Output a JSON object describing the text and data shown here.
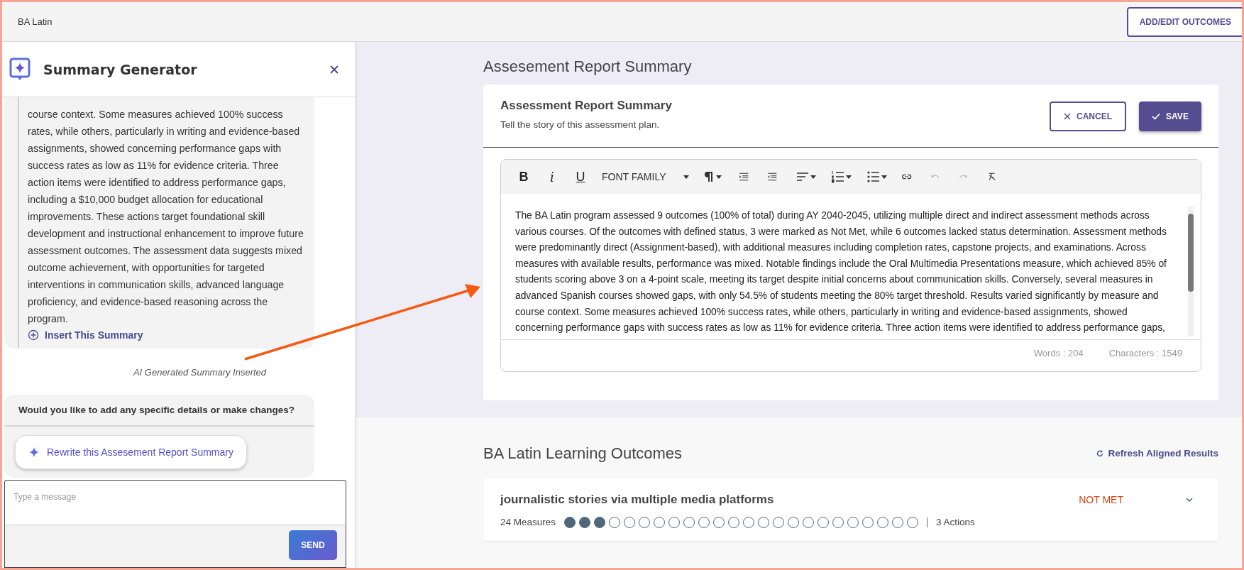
{
  "header": {
    "title": "BA Latin",
    "action": "ADD/EDIT OUTCOMES"
  },
  "summary_generator": {
    "title": "Summary Generator",
    "messages": [
      {
        "kind": "summary",
        "text": "course context. Some measures achieved 100% success rates, while others, particularly in writing and evidence-based assignments, showed concerning performance gaps with success rates as low as 11% for evidence criteria. Three action items were identified to address performance gaps, including a $10,000 budget allocation for educational improvements. These actions target foundational skill development and instructional enhancement to improve future assessment outcomes. The assessment data suggests mixed outcome achievement, with opportunities for targeted interventions in communication skills, advanced language proficiency, and evidence-based reasoning across the program.",
        "action": "Insert This Summary"
      },
      {
        "kind": "status",
        "text": "AI Generated Summary Inserted"
      },
      {
        "kind": "question",
        "text": "Would you like to add any specific details or make changes?",
        "action": "Rewrite this Assesement Report Summary"
      }
    ],
    "input": {
      "placeholder": "Type a message"
    },
    "send": "SEND"
  },
  "report": {
    "section_title": "Assesement Report Summary",
    "card_title": "Assessment Report Summary",
    "subtitle": "Tell the story of this assessment plan.",
    "cancel": "CANCEL",
    "save": "SAVE",
    "toolbar": [
      {
        "kind": "bold",
        "label": "B",
        "disabled": false
      },
      {
        "kind": "italic",
        "label": "i",
        "disabled": false
      },
      {
        "kind": "underline",
        "label": "U",
        "disabled": false
      },
      {
        "kind": "font",
        "label": "FONT FAMILY",
        "disabled": false
      },
      {
        "kind": "paragraph",
        "disabled": false
      },
      {
        "kind": "indent",
        "disabled": false
      },
      {
        "kind": "outdent",
        "disabled": false
      },
      {
        "kind": "align",
        "disabled": false
      },
      {
        "kind": "ordered",
        "disabled": false
      },
      {
        "kind": "bullets",
        "disabled": false
      },
      {
        "kind": "link",
        "disabled": false
      },
      {
        "kind": "undo",
        "disabled": true
      },
      {
        "kind": "redo",
        "disabled": true
      },
      {
        "kind": "clear",
        "disabled": false
      }
    ],
    "body": "The BA Latin program assessed 9 outcomes (100% of total) during AY 2040-2045, utilizing multiple direct and indirect assessment methods across various courses. Of the outcomes with defined status, 3 were marked as Not Met, while 6 outcomes lacked status determination. Assessment methods were predominantly direct (Assignment-based), with additional measures including completion rates, capstone projects, and examinations. Across measures with available results, performance was mixed. Notable findings include the Oral Multimedia Presentations measure, which achieved 85% of students scoring above 3 on a 4-point scale, meeting its target despite initial concerns about communication skills. Conversely, several measures in advanced Spanish courses showed gaps, with only 54.5% of students meeting the 80% target threshold. Results varied significantly by measure and course context. Some measures achieved 100% success rates, while others, particularly in writing and evidence-based assignments, showed concerning performance gaps with success rates as low as 11% for evidence criteria. Three action items were identified to address performance gaps,",
    "words": "Words : 204",
    "characters": "Characters : 1549"
  },
  "outcomes": {
    "title": "BA Latin Learning Outcomes",
    "refresh": "Refresh Aligned Results",
    "items": [
      {
        "title": "journalistic stories via multiple media platforms",
        "status": "NOT MET",
        "measures_label": "24 Measures",
        "actions_label": "3 Actions",
        "measures": [
          {
            "met": true
          },
          {
            "met": true
          },
          {
            "met": true
          },
          {
            "met": false
          },
          {
            "met": false
          },
          {
            "met": false
          },
          {
            "met": false
          },
          {
            "met": false
          },
          {
            "met": false
          },
          {
            "met": false
          },
          {
            "met": false
          },
          {
            "met": false
          },
          {
            "met": false
          },
          {
            "met": false
          },
          {
            "met": false
          },
          {
            "met": false
          },
          {
            "met": false
          },
          {
            "met": false
          },
          {
            "met": false
          },
          {
            "met": false
          },
          {
            "met": false
          },
          {
            "met": false
          },
          {
            "met": false
          },
          {
            "met": false
          }
        ]
      }
    ]
  }
}
